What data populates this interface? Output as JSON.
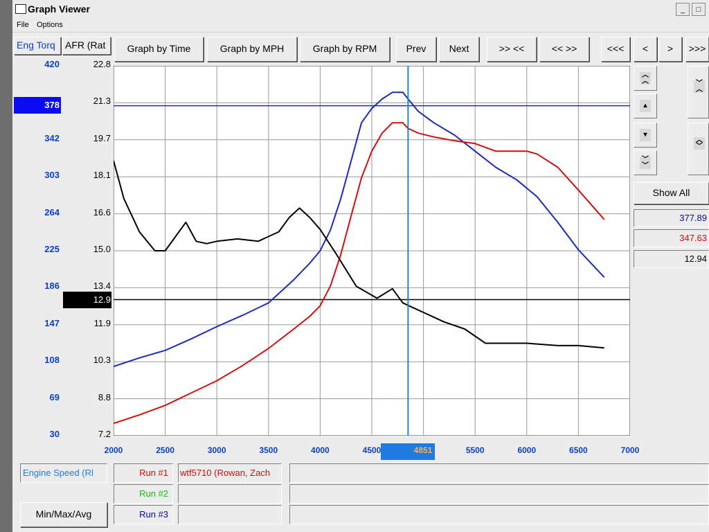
{
  "window": {
    "title": "Graph Viewer"
  },
  "menu": [
    "File",
    "Options"
  ],
  "toolbar": {
    "graph_by_time": "Graph by Time",
    "graph_by_mph": "Graph by MPH",
    "graph_by_rpm": "Graph by RPM",
    "prev": "Prev",
    "next": "Next",
    "zoom_in": ">> <<",
    "zoom_out": "<< >>",
    "first": "<<<",
    "back": "<",
    "forward": ">",
    "last": ">>>"
  },
  "axis_tabs": {
    "left": "Eng Torq",
    "right": "AFR (Rat"
  },
  "y_torque_ticks": [
    "420",
    "378",
    "342",
    "303",
    "264",
    "225",
    "186",
    "147",
    "108",
    "69",
    "30"
  ],
  "y_afr_ticks": [
    "22.8",
    "21.3",
    "19.7",
    "18.1",
    "16.6",
    "15.0",
    "13.4",
    "12.9",
    "11.9",
    "10.3",
    "8.8",
    "7.2"
  ],
  "torque_highlight": "378",
  "afr_highlight": "12.9",
  "x_ticks": [
    "2000",
    "2500",
    "3000",
    "3500",
    "4000",
    "4500",
    "4851",
    "5500",
    "6000",
    "6500",
    "7000"
  ],
  "cursor_rpm": "4851",
  "side": {
    "show_all": "Show All",
    "value_1": "377.89",
    "value_2": "347.63",
    "value_3": "12.94"
  },
  "bottom": {
    "x_field": "Engine Speed (Rl",
    "run1": "Run #1",
    "run2": "Run #2",
    "run3": "Run #3",
    "run1_file": "wtf5710 (Rowan, Zach",
    "minmax": "Min/Max/Avg"
  },
  "colors": {
    "run1": "#cc1010",
    "run2": "#10c010",
    "run3": "#0a0aa8",
    "accent": "#1e7be0"
  },
  "chart_data": {
    "type": "line",
    "xlabel": "Engine Speed (Rl",
    "xlim": [
      2000,
      7000
    ],
    "series": [
      {
        "name": "Eng Torq",
        "axis": "left",
        "color": "#1a2aba",
        "ylim": [
          30,
          420
        ],
        "x": [
          2000,
          2250,
          2500,
          2750,
          3000,
          3250,
          3500,
          3750,
          3900,
          4000,
          4100,
          4200,
          4300,
          4400,
          4500,
          4600,
          4700,
          4800,
          4851,
          4950,
          5100,
          5300,
          5500,
          5700,
          5900,
          6100,
          6300,
          6500,
          6750
        ],
        "y": [
          103,
          112,
          120,
          132,
          145,
          157,
          170,
          195,
          212,
          225,
          247,
          280,
          320,
          360,
          375,
          385,
          392,
          392,
          385,
          372,
          360,
          347,
          330,
          313,
          300,
          282,
          255,
          226,
          197
        ]
      },
      {
        "name": "Run #1",
        "axis": "left",
        "color": "#cc1010",
        "ylim": [
          30,
          420
        ],
        "x": [
          2000,
          2250,
          2500,
          2750,
          3000,
          3250,
          3500,
          3750,
          3900,
          4000,
          4100,
          4200,
          4300,
          4400,
          4500,
          4600,
          4700,
          4800,
          4851,
          4950,
          5100,
          5300,
          5500,
          5700,
          5900,
          6000,
          6100,
          6300,
          6500,
          6750
        ],
        "y": [
          43,
          52,
          62,
          75,
          88,
          104,
          122,
          143,
          156,
          167,
          188,
          221,
          262,
          302,
          330,
          349,
          360,
          360,
          354,
          349,
          345,
          341,
          338,
          330,
          330,
          330,
          327,
          313,
          289,
          258
        ]
      },
      {
        "name": "AFR",
        "axis": "right",
        "color": "#000000",
        "ylim": [
          7.2,
          22.8
        ],
        "x": [
          2000,
          2100,
          2250,
          2400,
          2500,
          2600,
          2700,
          2800,
          2900,
          3000,
          3200,
          3400,
          3600,
          3700,
          3800,
          3900,
          4000,
          4150,
          4350,
          4550,
          4700,
          4800,
          4900,
          5000,
          5200,
          5400,
          5600,
          5800,
          6000,
          6300,
          6500,
          6750
        ],
        "y": [
          18.8,
          17.2,
          15.8,
          15.0,
          15.0,
          15.6,
          16.2,
          15.4,
          15.3,
          15.4,
          15.5,
          15.4,
          15.8,
          16.4,
          16.8,
          16.4,
          15.9,
          14.9,
          13.5,
          13.0,
          13.4,
          12.8,
          12.6,
          12.4,
          12.0,
          11.7,
          11.1,
          11.1,
          11.1,
          11.0,
          11.0,
          10.9
        ]
      }
    ]
  }
}
